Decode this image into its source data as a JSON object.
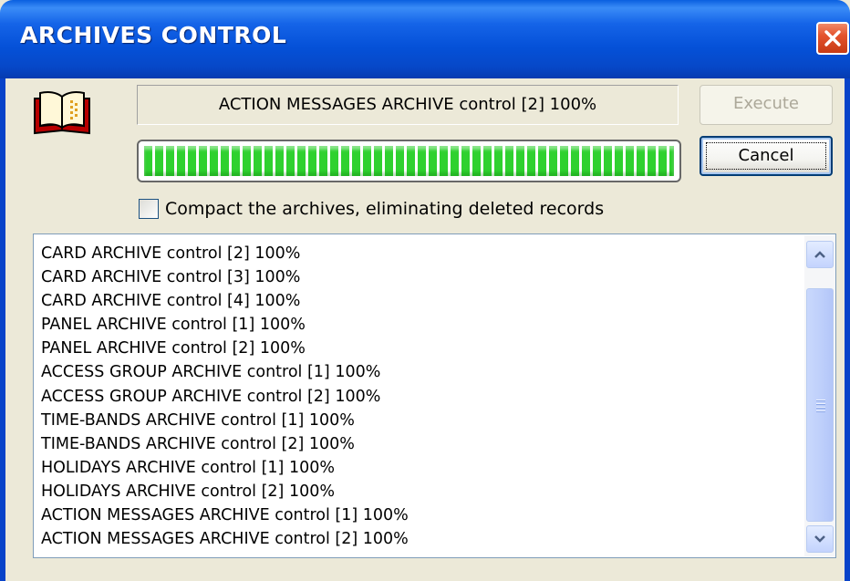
{
  "window": {
    "title": "ARCHIVES CONTROL",
    "close_icon": "close-icon"
  },
  "app_icon": "open-book-icon",
  "status": {
    "text": "ACTION MESSAGES ARCHIVE control [2] 100%"
  },
  "progress": {
    "percent": 100,
    "color": "#2fd12f"
  },
  "buttons": {
    "execute_label": "Execute",
    "execute_enabled": false,
    "cancel_label": "Cancel"
  },
  "options": {
    "compact_label": "Compact the archives, eliminating deleted records",
    "compact_checked": false
  },
  "log": {
    "items": [
      "CARD ARCHIVE control [2] 100%",
      "CARD ARCHIVE control [3] 100%",
      "CARD ARCHIVE control [4] 100%",
      "PANEL ARCHIVE control [1] 100%",
      "PANEL ARCHIVE control [2] 100%",
      "ACCESS GROUP ARCHIVE control [1] 100%",
      "ACCESS GROUP ARCHIVE control [2] 100%",
      "TIME-BANDS ARCHIVE control [1] 100%",
      "TIME-BANDS ARCHIVE control [2] 100%",
      "HOLIDAYS ARCHIVE control [1] 100%",
      "HOLIDAYS ARCHIVE control [2] 100%",
      "ACTION MESSAGES ARCHIVE control [1] 100%",
      "ACTION MESSAGES ARCHIVE control [2] 100%"
    ]
  },
  "colors": {
    "titlebar": "#0551d8",
    "dialog_bg": "#ece9d8",
    "close_button": "#e4532d"
  }
}
